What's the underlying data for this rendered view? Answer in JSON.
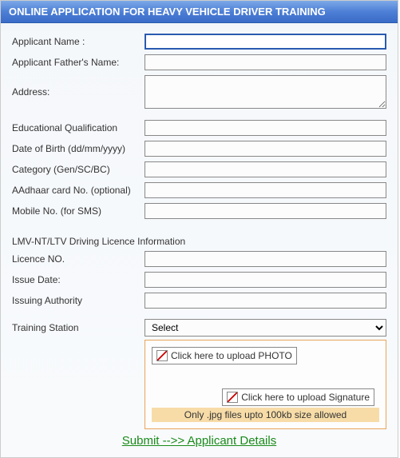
{
  "header": {
    "title": "ONLINE APPLICATION FOR HEAVY VEHICLE DRIVER TRAINING"
  },
  "labels": {
    "applicant_name": "Applicant Name :",
    "father_name": "Applicant Father's Name:",
    "address": "Address:",
    "edu": "Educational Qualification",
    "dob": "Date of Birth (dd/mm/yyyy)",
    "category": "Category (Gen/SC/BC)",
    "aadhaar": "AAdhaar card No. (optional)",
    "mobile": "Mobile No. (for SMS)",
    "licence_section": "LMV-NT/LTV Driving Licence Information",
    "licence_no": "Licence NO.",
    "issue_date": "Issue Date:",
    "issuing_auth": "Issuing Authority",
    "training_station": "Training Station"
  },
  "values": {
    "applicant_name": "",
    "father_name": "",
    "address": "",
    "edu": "",
    "dob": "",
    "category": "",
    "aadhaar": "",
    "mobile": "",
    "licence_no": "",
    "issue_date": "",
    "issuing_auth": "",
    "training_station": "Select"
  },
  "upload": {
    "photo_text": "Click here to upload PHOTO",
    "signature_text": "Click here to upload Signature",
    "note": "Only .jpg files upto 100kb size allowed"
  },
  "submit": {
    "label": "Submit -->> Applicant Details"
  }
}
